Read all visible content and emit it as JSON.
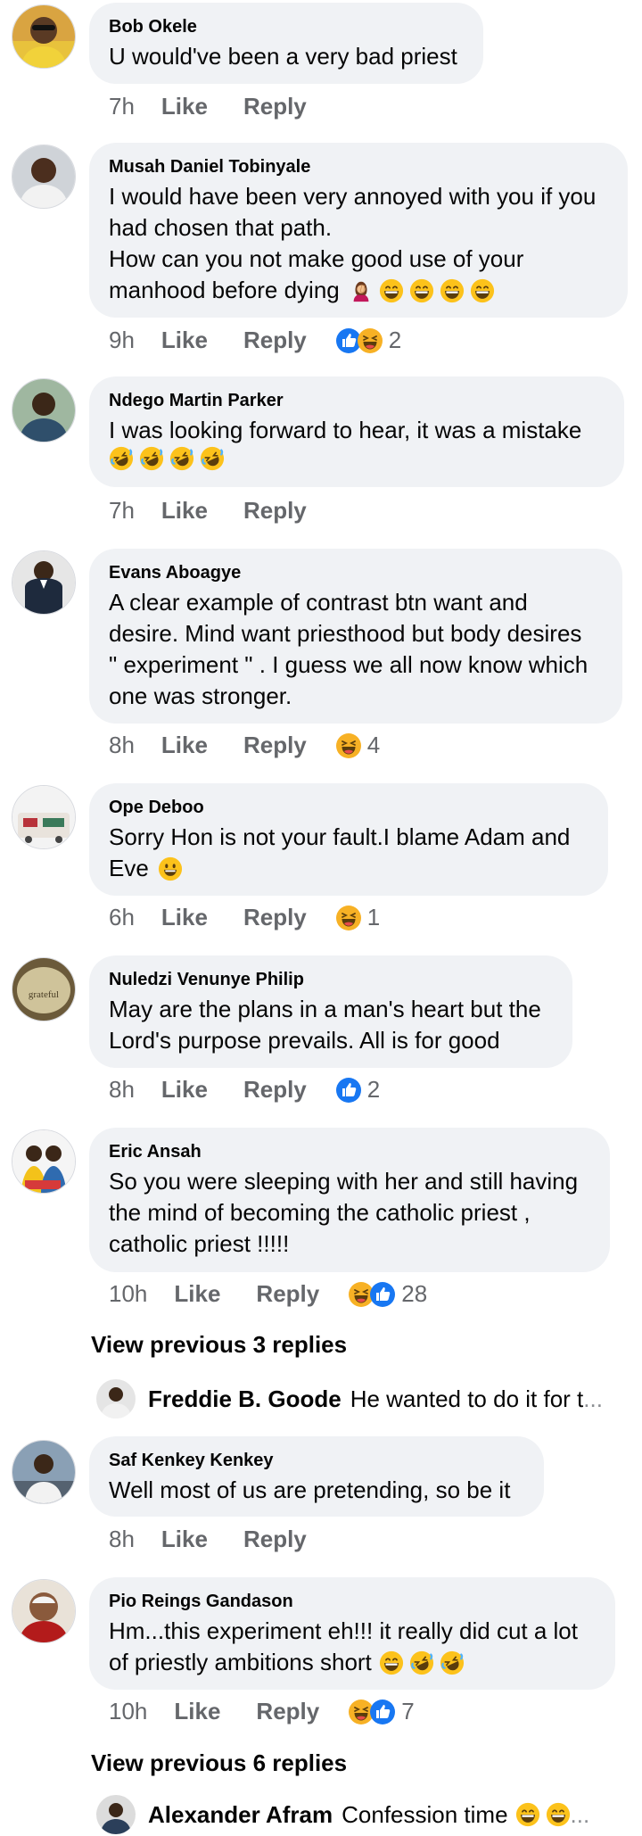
{
  "comments": [
    {
      "name": "Bob Okele",
      "lines": [
        "U would've been a very bad priest"
      ],
      "time": "7h",
      "like": "Like",
      "reply": "Reply",
      "count": ""
    },
    {
      "name": "Musah Daniel Tobinyale",
      "lines": [
        "I would have been very annoyed with you if you",
        "had chosen that path.",
        "How can you not make good use of your",
        "manhood before dying"
      ],
      "time": "9h",
      "like": "Like",
      "reply": "Reply",
      "count": "2"
    },
    {
      "name": "Ndego Martin Parker",
      "lines": [
        "I was looking forward to hear, it was a mistake"
      ],
      "time": "7h",
      "like": "Like",
      "reply": "Reply",
      "count": ""
    },
    {
      "name": "Evans Aboagye",
      "lines": [
        "A clear example of contrast btn want and",
        "desire. Mind want priesthood but body desires",
        "\" experiment \" . I guess we all now know which",
        "one was stronger."
      ],
      "time": "8h",
      "like": "Like",
      "reply": "Reply",
      "count": "4"
    },
    {
      "name": "Ope Deboo",
      "lines": [
        "Sorry Hon is not your fault.I blame Adam and",
        "Eve"
      ],
      "time": "6h",
      "like": "Like",
      "reply": "Reply",
      "count": "1"
    },
    {
      "name": "Nuledzi Venunye Philip",
      "lines": [
        "May are the plans in a man's heart but the",
        "Lord's purpose prevails. All is for good"
      ],
      "time": "8h",
      "like": "Like",
      "reply": "Reply",
      "count": "2",
      "avatar_text": "grateful"
    },
    {
      "name": "Eric Ansah",
      "lines": [
        "So you were sleeping with her and still having",
        "the mind of becoming the catholic priest ,",
        "catholic priest !!!!!"
      ],
      "time": "10h",
      "like": "Like",
      "reply": "Reply",
      "count": "28"
    },
    {
      "name": "Saf Kenkey Kenkey",
      "lines": [
        "Well most of us are pretending, so be it"
      ],
      "time": "8h",
      "like": "Like",
      "reply": "Reply",
      "count": ""
    },
    {
      "name": "Pio Reings Gandason",
      "lines": [
        "Hm...this experiment eh!!! it really did cut a lot",
        "of priestly ambitions short"
      ],
      "time": "10h",
      "like": "Like",
      "reply": "Reply",
      "count": "7"
    }
  ],
  "view_previous_1": "View previous 3 replies",
  "reply_preview_1": {
    "name": "Freddie B. Goode",
    "text": "He wanted to do it for t",
    "ellipsis": "..."
  },
  "view_previous_2": "View previous 6 replies",
  "reply_preview_2": {
    "name": "Alexander Afram",
    "text": "Confession time",
    "ellipsis": "..."
  },
  "colors": {
    "bubble": "#f0f2f5",
    "meta": "#65676b",
    "like_blue": "#1877f2",
    "haha_yellow": "#f7b125"
  },
  "icons": {
    "like": "thumbs-up-icon",
    "haha": "haha-emoji-icon",
    "grin": "grinning-emoji-icon",
    "rofl": "rofl-emoji-icon",
    "facepalm": "facepalm-emoji-icon",
    "smile": "smiley-emoji-icon"
  }
}
